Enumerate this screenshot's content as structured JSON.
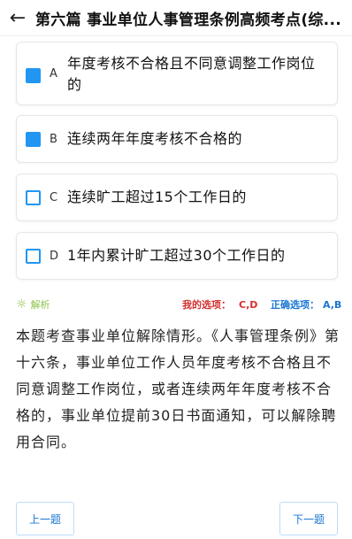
{
  "header": {
    "back_icon": "arrow-left-icon",
    "title": "第六篇 事业单位人事管理条例高频考点(综..."
  },
  "options": [
    {
      "letter": "A",
      "text": "年度考核不合格且不同意调整工作岗位的",
      "checked": true
    },
    {
      "letter": "B",
      "text": "连续两年年度考核不合格的",
      "checked": true
    },
    {
      "letter": "C",
      "text": "连续旷工超过15个工作日的",
      "checked": false
    },
    {
      "letter": "D",
      "text": "1年内累计旷工超过30个工作日的",
      "checked": false
    }
  ],
  "analysis": {
    "icon": "lightbulb-icon",
    "label": "解析",
    "my_choice_label": "我的选项：",
    "my_choice": "C,D",
    "correct_label": "正确选项：",
    "correct": "A,B",
    "text": "本题考查事业单位解除情形。《人事管理条例》第十六条，事业单位工作人员年度考核不合格且不同意调整工作岗位，或者连续两年年度考核不合格的，事业单位提前30日书面通知，可以解除聘用合同。"
  },
  "nav": {
    "prev_label": "上一题",
    "next_label": "下一题"
  },
  "colors": {
    "accent": "#2196f3",
    "error": "#d32f2f",
    "correct": "#1976d2",
    "hint": "#8bc34a"
  }
}
